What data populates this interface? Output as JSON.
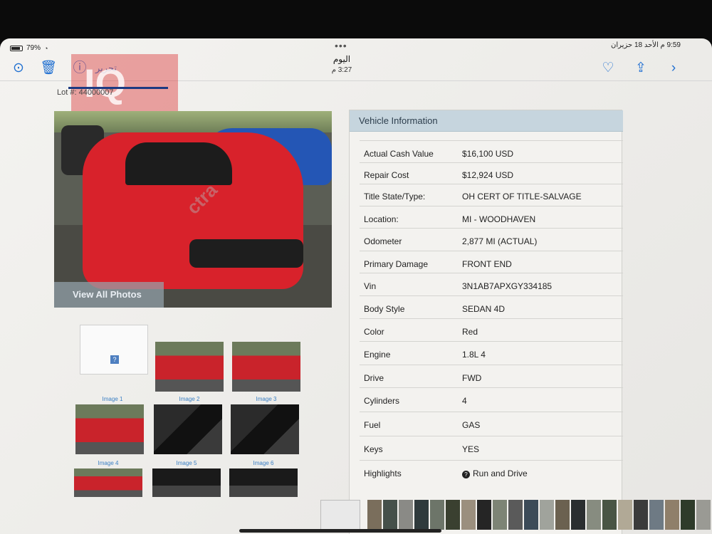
{
  "status_bar": {
    "battery": "79%",
    "datetime": "9:59 م الأحد 18 حزيران",
    "dots": "•••"
  },
  "toolbar": {
    "edit_label": "تحرير",
    "title": "اليوم",
    "time": "3:27 م",
    "icons": [
      "more-circle-icon",
      "trash-icon",
      "info-icon",
      "heart-icon",
      "share-icon",
      "chevron-right-icon"
    ]
  },
  "lot_label": "Lot #: 44000007",
  "watermark": {
    "logo_text": "IQ",
    "diag_text": "ctra"
  },
  "main_photo": {
    "view_all_label": "View All Photos"
  },
  "thumbnails": [
    {
      "label": "Image 1"
    },
    {
      "label": "Image 2"
    },
    {
      "label": "Image 3"
    },
    {
      "label": "Image 4"
    },
    {
      "label": "Image 5"
    },
    {
      "label": "Image 6"
    }
  ],
  "vehicle_info": {
    "title": "Vehicle Information",
    "rows": [
      {
        "key": "Actual Cash Value",
        "value": "$16,100 USD"
      },
      {
        "key": "Repair Cost",
        "value": "$12,924 USD"
      },
      {
        "key": "Title State/Type:",
        "value": "OH CERT OF TITLE-SALVAGE"
      },
      {
        "key": "Location:",
        "value": "MI - WOODHAVEN"
      },
      {
        "key": "Odometer",
        "value": "2,877 MI (ACTUAL)"
      },
      {
        "key": "Primary Damage",
        "value": "FRONT END"
      },
      {
        "key": "Vin",
        "value": "3N1AB7APXGY334185"
      },
      {
        "key": "Body Style",
        "value": "SEDAN 4D"
      },
      {
        "key": "Color",
        "value": "Red"
      },
      {
        "key": "Engine",
        "value": "1.8L 4"
      },
      {
        "key": "Drive",
        "value": "FWD"
      },
      {
        "key": "Cylinders",
        "value": "4"
      },
      {
        "key": "Fuel",
        "value": "GAS"
      },
      {
        "key": "Keys",
        "value": "YES"
      },
      {
        "key": "Highlights",
        "value": "Run and Drive"
      }
    ]
  },
  "colors": {
    "accent": "#1f6fd1",
    "panel_header": "#c6d5de",
    "thumb_label": "#3a7fc4"
  }
}
